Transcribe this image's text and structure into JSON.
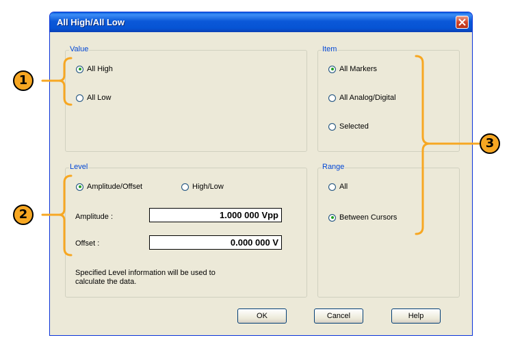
{
  "window": {
    "title": "All High/All Low"
  },
  "value_group": {
    "legend": "Value",
    "options": [
      "All High",
      "All Low"
    ],
    "selected": "All High"
  },
  "item_group": {
    "legend": "Item",
    "options": [
      "All Markers",
      "All Analog/Digital",
      "Selected"
    ],
    "selected": "All Markers"
  },
  "level_group": {
    "legend": "Level",
    "modes": [
      "Amplitude/Offset",
      "High/Low"
    ],
    "selected_mode": "Amplitude/Offset",
    "amplitude_label": "Amplitude :",
    "amplitude_value": "1.000 000 Vpp",
    "offset_label": "Offset :",
    "offset_value": "0.000 000 V",
    "info_line1": "Specified Level information will be used to",
    "info_line2": "calculate the data."
  },
  "range_group": {
    "legend": "Range",
    "options": [
      "All",
      "Between Cursors"
    ],
    "selected": "Between Cursors"
  },
  "buttons": {
    "ok": "OK",
    "cancel": "Cancel",
    "help": "Help"
  },
  "callouts": [
    "1",
    "2",
    "3"
  ],
  "colors": {
    "title_bar": "#0b58d8",
    "callout": "#f7a722",
    "bracket": "#f7a722",
    "legend_text": "#0046d5"
  }
}
